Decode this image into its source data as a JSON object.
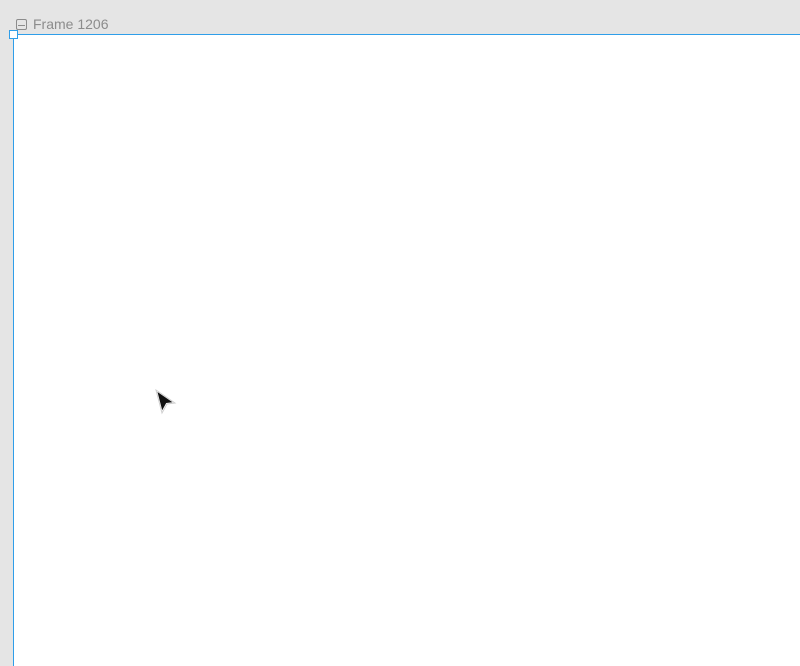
{
  "frame": {
    "label": "Frame 1206",
    "icon": "frame-icon"
  },
  "colors": {
    "canvas_background": "#e5e5e5",
    "frame_background": "#ffffff",
    "selection_blue": "#2f9ee9",
    "label_gray": "#8c8c8c"
  },
  "cursor": {
    "icon": "arrow-cursor-icon"
  }
}
